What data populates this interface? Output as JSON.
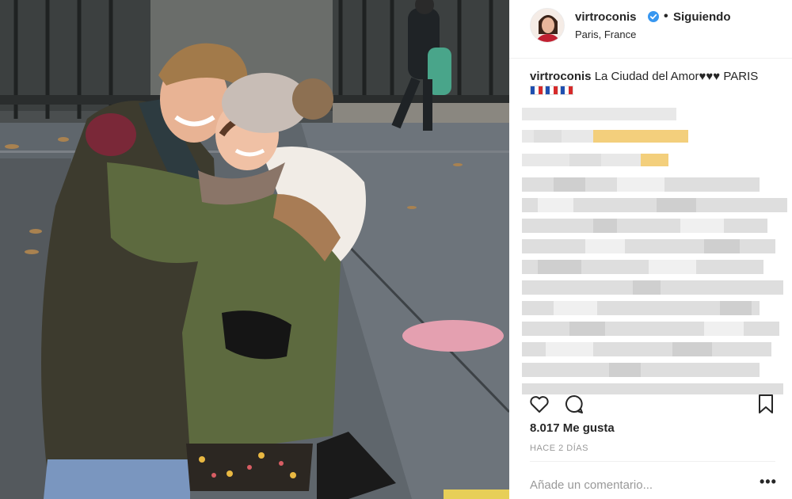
{
  "post": {
    "username": "virtroconis",
    "follow_status": "Siguiendo",
    "separator": "•",
    "location": "Paris, France",
    "caption_user": "virtroconis",
    "caption_text": "La Ciudad del Amor♥♥♥ PARIS",
    "flags": [
      "french-flag",
      "french-flag",
      "french-flag"
    ],
    "likes": "8.017 Me gusta",
    "time_ago": "HACE 2 DÍAS",
    "comment_placeholder": "Añade un comentario...",
    "more_label": "•••"
  },
  "icons": {
    "like": "heart-icon",
    "comment": "comment-icon",
    "save": "bookmark-icon",
    "verified": "verified-badge-icon",
    "options": "more-options-icon"
  },
  "colors": {
    "verified_blue": "#3897f0",
    "text": "#262626",
    "muted": "#999999",
    "divider": "#efefef",
    "pixel_highlight": "#f3cf7c"
  }
}
